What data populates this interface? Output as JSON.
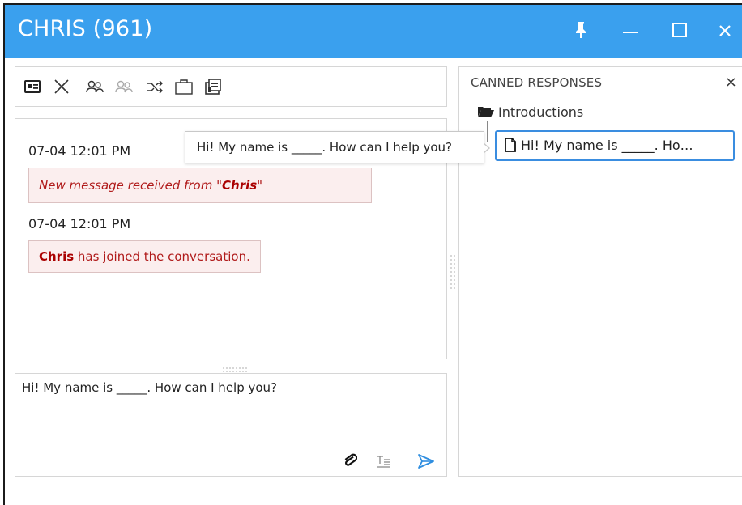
{
  "window": {
    "title": "CHRIS (961)",
    "title_bar_color": "#3aa0ee",
    "controls": [
      "pin-icon",
      "minimize-icon",
      "maximize-icon",
      "close-icon"
    ]
  },
  "toolbar": {
    "icons": [
      "contact-card-icon",
      "close-conversation-icon",
      "add-participant-icon",
      "remove-participant-icon",
      "transfer-icon",
      "briefcase-icon",
      "transcript-icon"
    ]
  },
  "chat": {
    "messages": [
      {
        "timestamp": "07-04 12:01 PM",
        "prefix": "New message received from \"",
        "name": "Chris",
        "suffix": "\""
      },
      {
        "timestamp": "07-04 12:01 PM",
        "name": "Chris",
        "text": " has joined the conversation."
      }
    ]
  },
  "compose": {
    "value": "Hi! My name is _____. How can I help you?",
    "icons": [
      "attach-icon",
      "format-text-icon",
      "send-icon"
    ]
  },
  "canned": {
    "title": "CANNED RESPONSES",
    "close": "×",
    "folder": "Introductions",
    "item": "Hi! My name is _____. Ho…",
    "tooltip": "Hi! My name is _____. How can I help you?"
  }
}
